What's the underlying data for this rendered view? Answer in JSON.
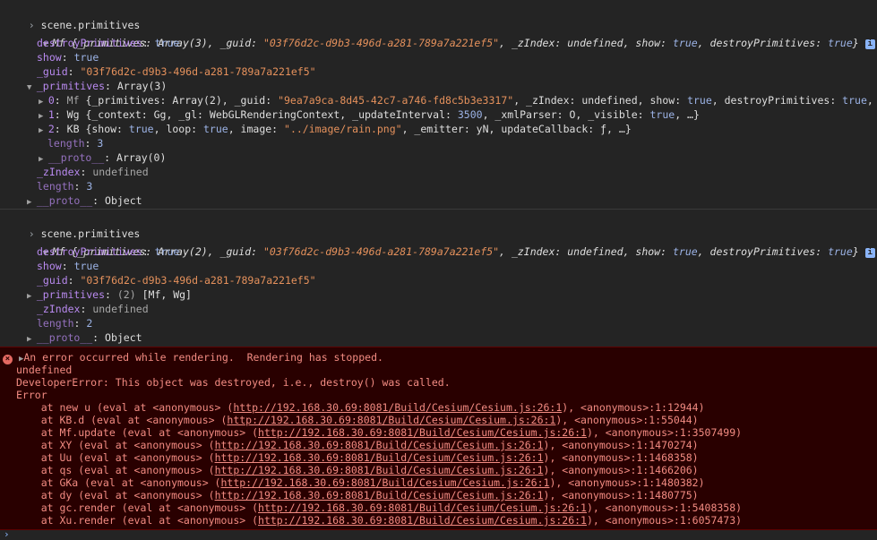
{
  "entries": [
    {
      "command": "scene.primitives",
      "summary": {
        "class": "Mf",
        "text_prefix": "{_primitives: ",
        "prim_val": "Array(3)",
        "guid_label": ", _guid: ",
        "guid": "\"03f76d2c-d9b3-496d-a281-789a7a221ef5\"",
        "zindex": ", _zIndex: undefined, show: ",
        "show": "true",
        "destroy": ", destroyPrimitives: ",
        "destroy_val": "true",
        "close": "}"
      },
      "props": {
        "destroyPrimitives_key": "destroyPrimitives",
        "destroyPrimitives_val": "true",
        "show_key": "show",
        "show_val": "true",
        "guid_key": "_guid",
        "guid_val": "\"03f76d2c-d9b3-496d-a281-789a7a221ef5\"",
        "primitives_key": "_primitives",
        "primitives_val": "Array(3)",
        "item0_idx": "0",
        "item0_cls": "Mf",
        "item0_a": "{_primitives: Array(2), _guid: ",
        "item0_guid": "\"9ea7a9ca-8d45-42c7-a746-fd8c5b3e3317\"",
        "item0_b": ", _zIndex: undefined, show: ",
        "item0_show": "true",
        "item0_c": ", destroyPrimitives: ",
        "item0_d": "true",
        "item0_e": ", …}",
        "item1_idx": "1",
        "item1_cls": "Wg",
        "item1_a": "{_context: Gg, _gl: WebGLRenderingContext, _updateInterval: ",
        "item1_num": "3500",
        "item1_b": ", _xmlParser: O, _visible: ",
        "item1_vis": "true",
        "item1_c": ", …}",
        "item2_idx": "2",
        "item2_cls": "KB",
        "item2_a": "{show: ",
        "item2_show": "true",
        "item2_b": ", loop: ",
        "item2_loop": "true",
        "item2_c": ", image: ",
        "item2_img": "\"../image/rain.png\"",
        "item2_d": ", _emitter: yN, updateCallback: ƒ, …}",
        "arr_length_key": "length",
        "arr_length_val": "3",
        "arr_proto_key": "__proto__",
        "arr_proto_val": "Array(0)",
        "zindex_key": "_zIndex",
        "zindex_val": "undefined",
        "length_key": "length",
        "length_val": "3",
        "proto_key": "__proto__",
        "proto_val": "Object"
      }
    },
    {
      "command": "scene.primitives",
      "summary": {
        "class": "Mf",
        "text_prefix": "{_primitives: ",
        "prim_val": "Array(2)",
        "guid_label": ", _guid: ",
        "guid": "\"03f76d2c-d9b3-496d-a281-789a7a221ef5\"",
        "zindex": ", _zIndex: undefined, show: ",
        "show": "true",
        "destroy": ", destroyPrimitives: ",
        "destroy_val": "true",
        "close": "}"
      },
      "props": {
        "destroyPrimitives_key": "destroyPrimitives",
        "destroyPrimitives_val": "true",
        "show_key": "show",
        "show_val": "true",
        "guid_key": "_guid",
        "guid_val": "\"03f76d2c-d9b3-496d-a281-789a7a221ef5\"",
        "primitives_key": "_primitives",
        "primitives_count": "(2)",
        "primitives_list": "[Mf, Wg]",
        "zindex_key": "_zIndex",
        "zindex_val": "undefined",
        "length_key": "length",
        "length_val": "2",
        "proto_key": "__proto__",
        "proto_val": "Object"
      }
    }
  ],
  "error": {
    "icon": "×",
    "message": "An error occurred while rendering.  Rendering has stopped.",
    "line2": "undefined",
    "line3": "DeveloperError: This object was destroyed, i.e., destroy() was called.",
    "line4": "Error",
    "stack": [
      {
        "pre": "    at new u (eval at <anonymous> (",
        "url": "http://192.168.30.69:8081/Build/Cesium/Cesium.js:26:1",
        "post": "), <anonymous>:1:12944)"
      },
      {
        "pre": "    at KB.d (eval at <anonymous> (",
        "url": "http://192.168.30.69:8081/Build/Cesium/Cesium.js:26:1",
        "post": "), <anonymous>:1:55044)"
      },
      {
        "pre": "    at Mf.update (eval at <anonymous> (",
        "url": "http://192.168.30.69:8081/Build/Cesium/Cesium.js:26:1",
        "post": "), <anonymous>:1:3507499)"
      },
      {
        "pre": "    at XY (eval at <anonymous> (",
        "url": "http://192.168.30.69:8081/Build/Cesium/Cesium.js:26:1",
        "post": "), <anonymous>:1:1470274)"
      },
      {
        "pre": "    at Uu (eval at <anonymous> (",
        "url": "http://192.168.30.69:8081/Build/Cesium/Cesium.js:26:1",
        "post": "), <anonymous>:1:1468358)"
      },
      {
        "pre": "    at qs (eval at <anonymous> (",
        "url": "http://192.168.30.69:8081/Build/Cesium/Cesium.js:26:1",
        "post": "), <anonymous>:1:1466206)"
      },
      {
        "pre": "    at GKa (eval at <anonymous> (",
        "url": "http://192.168.30.69:8081/Build/Cesium/Cesium.js:26:1",
        "post": "), <anonymous>:1:1480382)"
      },
      {
        "pre": "    at dy (eval at <anonymous> (",
        "url": "http://192.168.30.69:8081/Build/Cesium/Cesium.js:26:1",
        "post": "), <anonymous>:1:1480775)"
      },
      {
        "pre": "    at gc.render (eval at <anonymous> (",
        "url": "http://192.168.30.69:8081/Build/Cesium/Cesium.js:26:1",
        "post": "), <anonymous>:1:5408358)"
      },
      {
        "pre": "    at Xu.render (eval at <anonymous> (",
        "url": "http://192.168.30.69:8081/Build/Cesium/Cesium.js:26:1",
        "post": "), <anonymous>:1:6057473)"
      }
    ]
  },
  "bottom_prompt": "›"
}
